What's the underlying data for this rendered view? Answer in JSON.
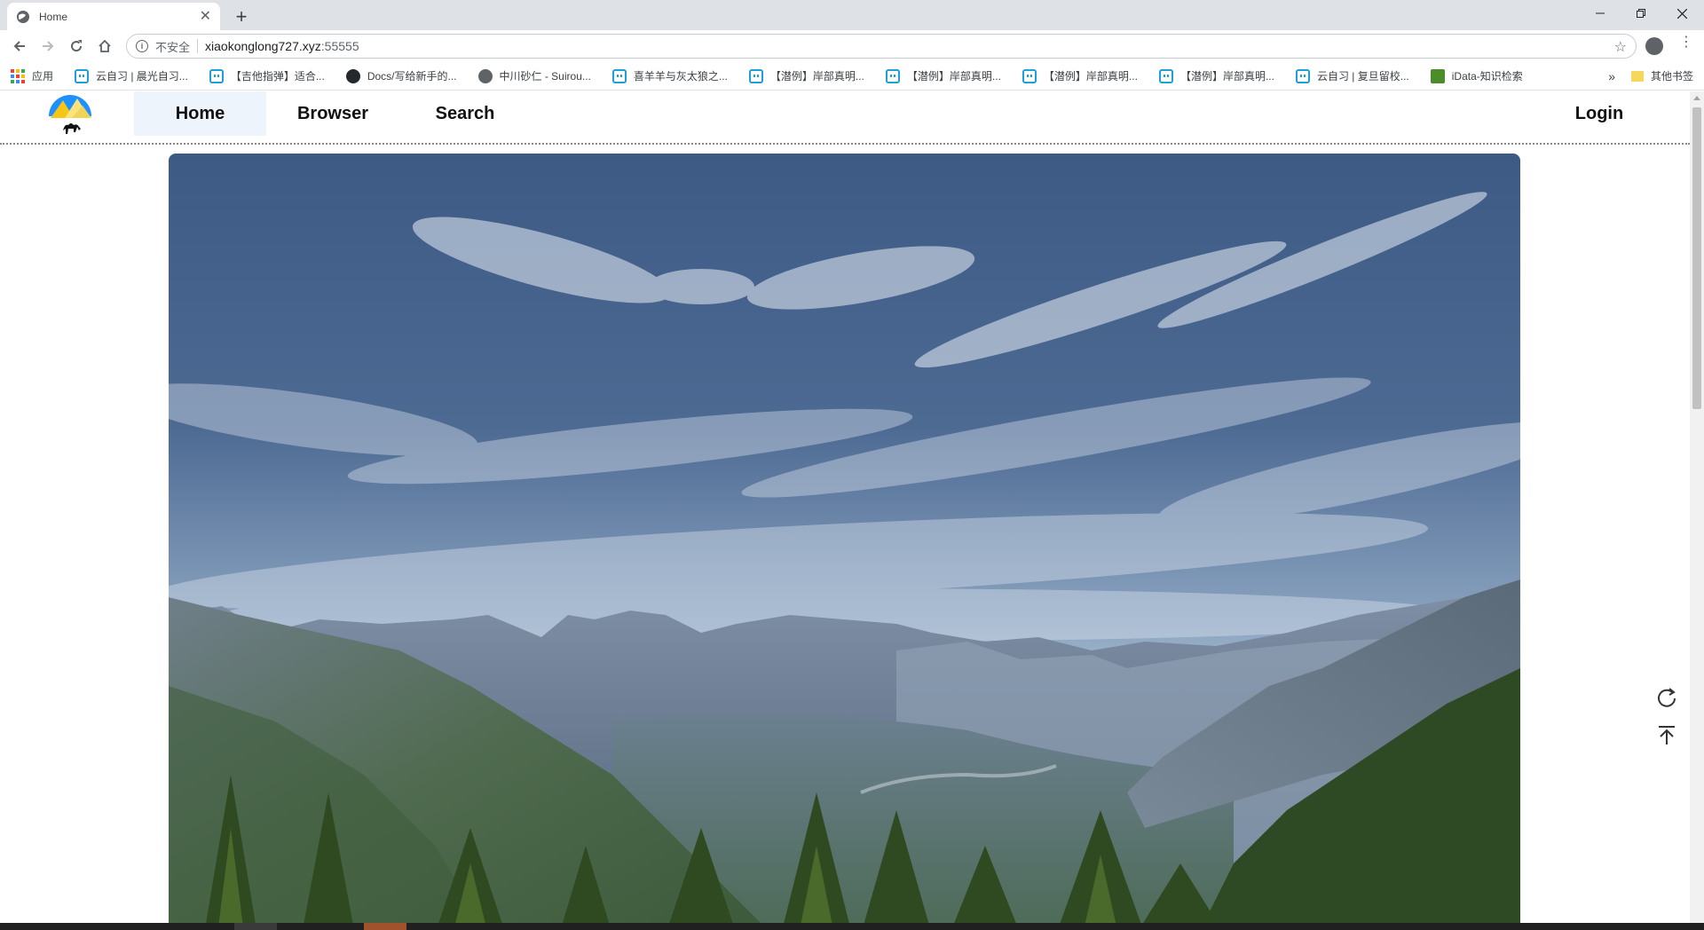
{
  "browser": {
    "tab": {
      "title": "Home"
    },
    "omnibox": {
      "security_label": "不安全",
      "url_host": "xiaokonglong727.xyz",
      "url_port": ":55555"
    },
    "bookmarks": [
      {
        "label": "应用",
        "icon": "apps-grid-icon"
      },
      {
        "label": "云自习 | 晨光自习...",
        "icon": "bilibili-icon"
      },
      {
        "label": "【吉他指弹】适合...",
        "icon": "bilibili-icon"
      },
      {
        "label": "Docs/写给新手的...",
        "icon": "github-icon"
      },
      {
        "label": "中川砂仁 - Suirou...",
        "icon": "globe-icon"
      },
      {
        "label": "喜羊羊与灰太狼之...",
        "icon": "bilibili-icon"
      },
      {
        "label": "【潜例】岸部真明...",
        "icon": "bilibili-icon"
      },
      {
        "label": "【潜例】岸部真明...",
        "icon": "bilibili-icon"
      },
      {
        "label": "【潜例】岸部真明...",
        "icon": "bilibili-icon"
      },
      {
        "label": "【潜例】岸部真明...",
        "icon": "bilibili-icon"
      },
      {
        "label": "云自习 | 复旦留校...",
        "icon": "bilibili-icon"
      },
      {
        "label": "iData-知识检索",
        "icon": "idata-icon"
      }
    ],
    "bookmarks_more": "»",
    "other_bookmarks": "其他书签"
  },
  "site": {
    "nav": {
      "home": "Home",
      "browser": "Browser",
      "search": "Search",
      "login": "Login"
    },
    "hero_image": "mountain-valley-landscape"
  },
  "colors": {
    "nav_active_bg": "#eef4fb",
    "omnibox_border": "#c7cdd4",
    "tabstrip_bg": "#dee1e6"
  }
}
